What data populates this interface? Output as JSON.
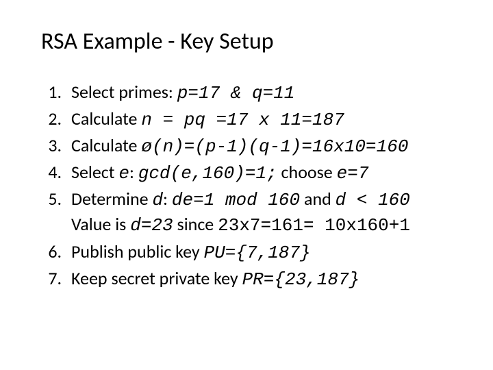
{
  "title": "RSA Example - Key Setup",
  "steps": {
    "s1": {
      "lead": "Select primes: ",
      "code": "p=17 & q=11"
    },
    "s2": {
      "lead": "Calculate ",
      "code": "n = pq =17 x 11=187"
    },
    "s3": {
      "lead": "Calculate ",
      "code": "ø(n)=(p-1)(q-1)=16x10=160"
    },
    "s4": {
      "lead": "Select ",
      "var": "e",
      "mid": ": ",
      "code": "gcd(e,160)=1;",
      "mid2": "  choose ",
      "code2": "e=7"
    },
    "s5": {
      "lead": "Determine ",
      "var": "d",
      "mid": ": ",
      "code": "de=1 mod 160",
      "mid2": " and ",
      "code2": "d < 160",
      "line2a": "Value is ",
      "code3": "d=23",
      "mid3": " since ",
      "code4": "23x7=161= 10x160+1"
    },
    "s6": {
      "lead": "Publish public key ",
      "code": "PU={7,187}"
    },
    "s7": {
      "lead": "Keep secret private key ",
      "code": "PR={23,187}"
    }
  }
}
